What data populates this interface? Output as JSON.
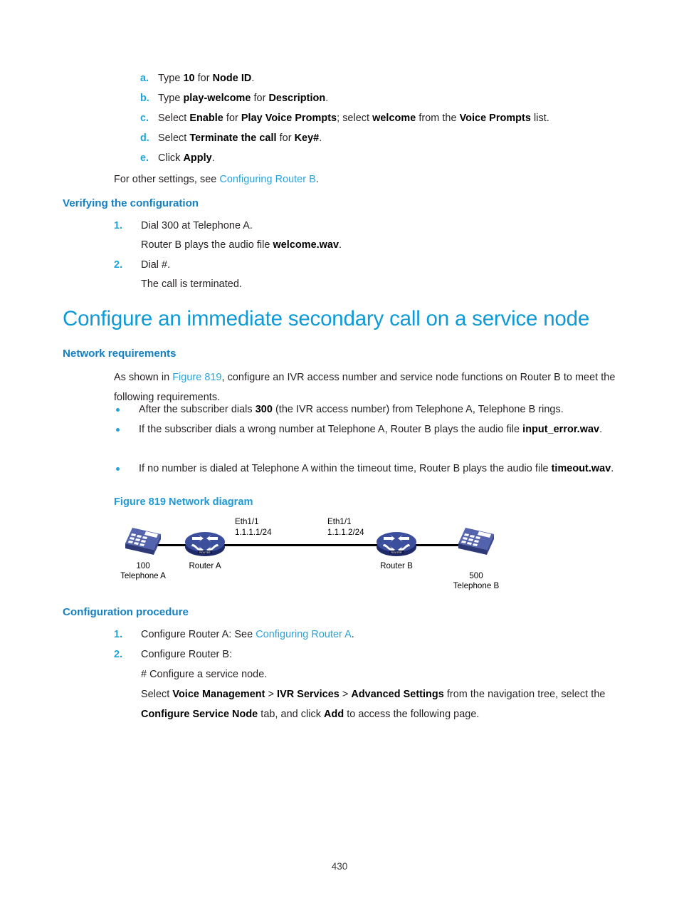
{
  "sub_steps": {
    "items": [
      {
        "marker": "a.",
        "html": "Type <b>10</b> for <b>Node ID</b>."
      },
      {
        "marker": "b.",
        "html": "Type <b>play-welcome</b> for <b>Description</b>."
      },
      {
        "marker": "c.",
        "html": "Select <b>Enable</b> for <b>Play Voice Prompts</b>; select <b>welcome</b> from the <b>Voice Prompts</b> list."
      },
      {
        "marker": "d.",
        "html": "Select <b>Terminate the call</b> for <b>Key#</b>."
      },
      {
        "marker": "e.",
        "html": "Click <b>Apply</b>."
      }
    ],
    "other_settings_html": "For other settings, see <span class=\"lnk\">Configuring Router B</span>."
  },
  "verifying": {
    "heading": "Verifying the configuration",
    "steps": [
      {
        "marker": "1.",
        "html": "Dial 300 at Telephone A."
      },
      {
        "marker": "",
        "html": "Router B plays the audio file <b>welcome.wav</b>."
      },
      {
        "marker": "2.",
        "html": "Dial #."
      },
      {
        "marker": "",
        "html": "The call is terminated."
      }
    ]
  },
  "main_heading": "Configure an immediate secondary call on a service node",
  "network_requirements": {
    "heading": "Network requirements",
    "intro_html": "As shown in <span class=\"lnk\">Figure 819</span>, configure an IVR access number and service node functions on Router B to meet the following requirements.",
    "bullets": [
      "After the subscriber dials <b>300</b> (the IVR access number) from Telephone A, Telephone B rings.",
      "If the subscriber dials a wrong number at Telephone A, Router B plays the audio file <b>input_error.wav</b>.",
      "If no number is dialed at Telephone A within the timeout time, Router B plays the audio file <b>timeout.wav</b>."
    ]
  },
  "figure": {
    "caption": "Figure 819 Network diagram",
    "nodes": {
      "telephone_a": {
        "number": "100",
        "name": "Telephone A"
      },
      "router_a": {
        "name": "Router A"
      },
      "router_b": {
        "name": "Router B"
      },
      "telephone_b": {
        "number": "500",
        "name": "Telephone B"
      }
    },
    "interfaces": {
      "left": {
        "port": "Eth1/1",
        "address": "1.1.1.1/24"
      },
      "right": {
        "port": "Eth1/1",
        "address": "1.1.1.2/24"
      }
    },
    "router_badge": "ROUTER"
  },
  "configuration_procedure": {
    "heading": "Configuration procedure",
    "steps": [
      {
        "marker": "1.",
        "html": "Configure Router A: See <span class=\"lnk\">Configuring Router A</span>."
      },
      {
        "marker": "2.",
        "html": "Configure Router B:"
      },
      {
        "marker": "",
        "html": "# Configure a service node."
      },
      {
        "marker": "",
        "html": "Select <b>Voice Management</b> &gt; <b>IVR Services</b> &gt; <b>Advanced Settings</b> from the navigation tree, select the <b>Configure Service Node</b> tab, and click <b>Add</b> to access the following page."
      }
    ]
  },
  "footer": {
    "page_number": "430"
  },
  "colors": {
    "heading_blue": "#0d9ad6",
    "subheading_blue": "#1581c2",
    "link_blue": "#29a3dc",
    "marker_blue": "#1da5dd",
    "body_text": "#231f20",
    "router_blue": "#3b4f9c",
    "phone_blue": "#4a5ba8",
    "line_black": "#000000"
  }
}
